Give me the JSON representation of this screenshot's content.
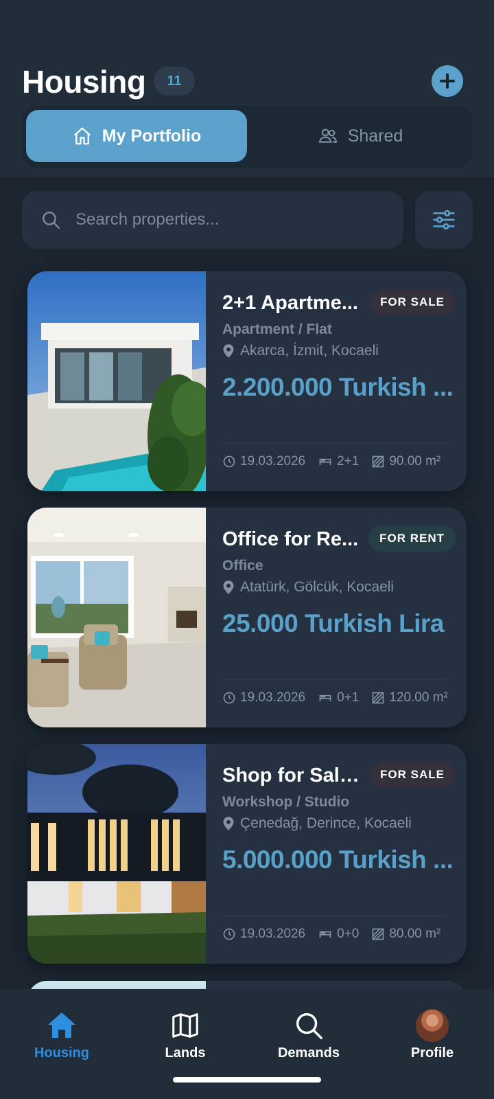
{
  "header": {
    "title": "Housing",
    "count": "11",
    "add_icon": "plus-icon"
  },
  "segmented": {
    "active_label": "My Portfolio",
    "inactive_label": "Shared"
  },
  "search": {
    "placeholder": "Search properties...",
    "filter_icon": "sliders-icon"
  },
  "listings": [
    {
      "title": "2+1 Apartme...",
      "tag": "FOR SALE",
      "type": "Apartment / Flat",
      "location": "Akarca, İzmit, Kocaeli",
      "price": "2.200.000 Turkish ...",
      "date": "19.03.2026",
      "rooms": "2+1",
      "area": "90.00 m²"
    },
    {
      "title": "Office for Re...",
      "tag": "FOR RENT",
      "type": "Office",
      "location": "Atatürk, Gölcük, Kocaeli",
      "price": "25.000 Turkish Lira",
      "date": "19.03.2026",
      "rooms": "0+1",
      "area": "120.00 m²"
    },
    {
      "title": "Shop for Sale...",
      "tag": "FOR SALE",
      "type": "Workshop / Studio",
      "location": "Çenedağ, Derince, Kocaeli",
      "price": "5.000.000 Turkish ...",
      "date": "19.03.2026",
      "rooms": "0+0",
      "area": "80.00 m²"
    }
  ],
  "nav": {
    "housing": "Housing",
    "lands": "Lands",
    "demands": "Demands",
    "profile": "Profile"
  },
  "colors": {
    "accent": "#5ca0cc",
    "nav_active": "#2d8fe0",
    "background": "#1a2530",
    "card": "#253140"
  }
}
